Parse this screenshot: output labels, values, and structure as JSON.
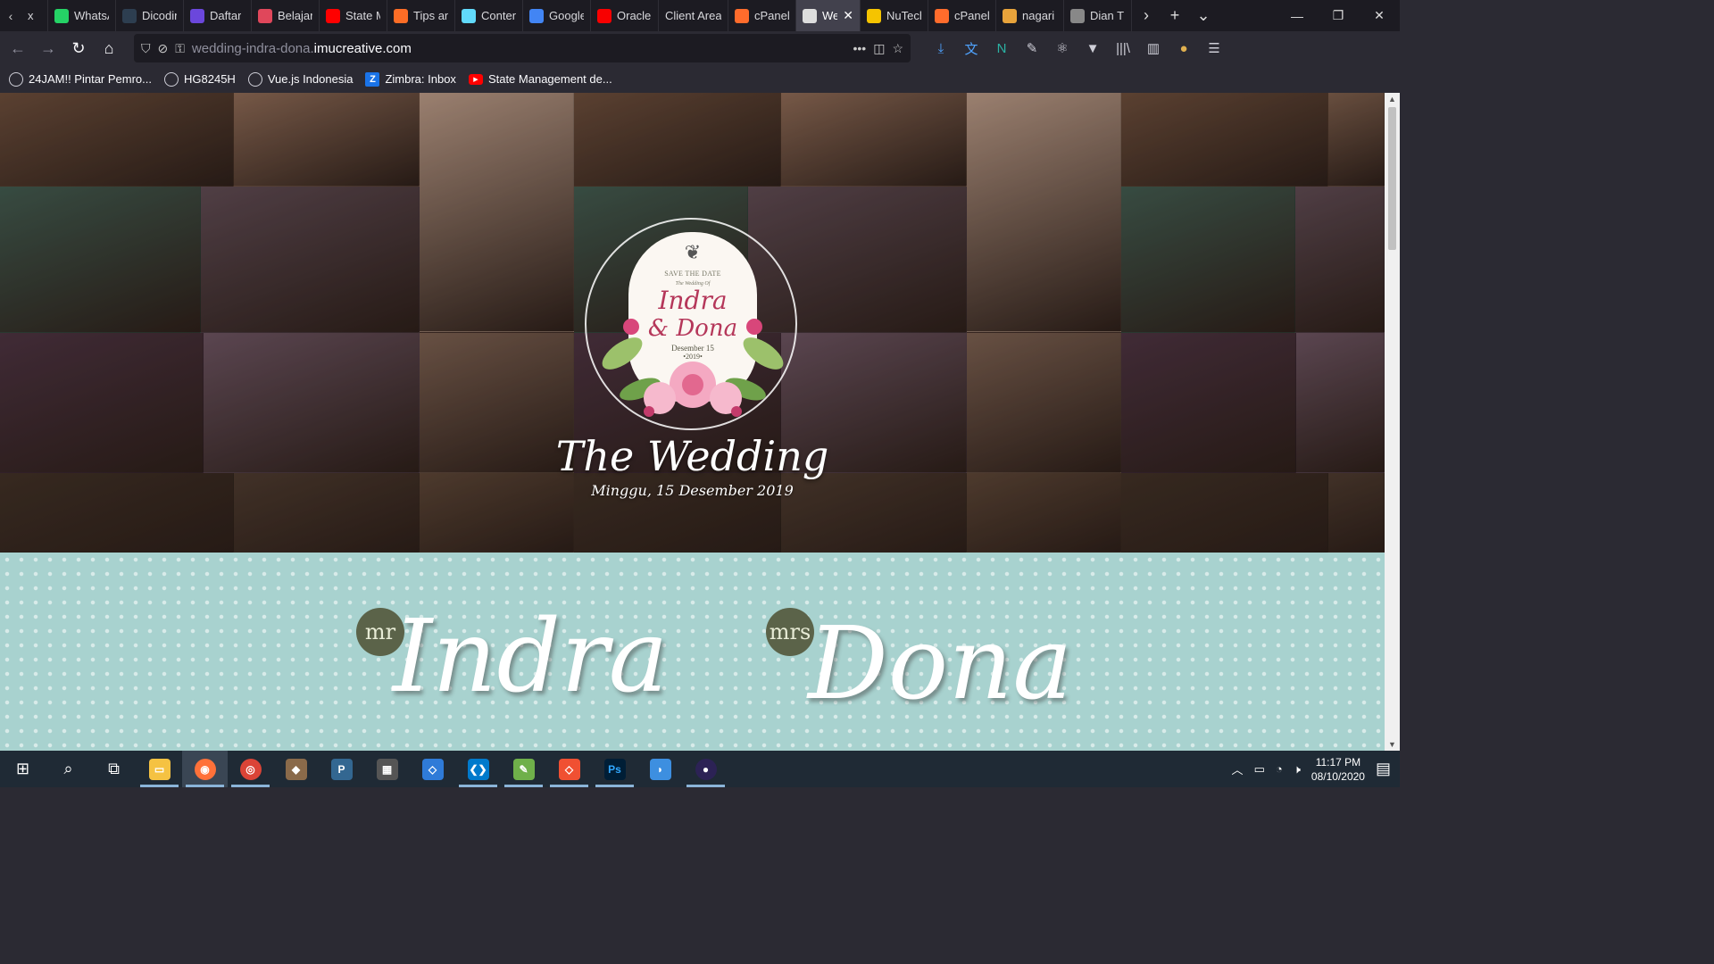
{
  "browser": {
    "tabs": [
      {
        "label": "x",
        "icon": "generic-tab-icon",
        "color": "#555"
      },
      {
        "label": "WhatsApp",
        "icon": "whatsapp-icon",
        "color": "#25d366"
      },
      {
        "label": "Dicoding",
        "icon": "dicoding-icon",
        "color": "#2d3e50"
      },
      {
        "label": "Daftar",
        "icon": "daftar-icon",
        "color": "#6b47dc"
      },
      {
        "label": "Belajar",
        "icon": "belajar-icon",
        "color": "#e0475b"
      },
      {
        "label": "State M",
        "icon": "youtube-icon",
        "color": "#ff0000"
      },
      {
        "label": "Tips an",
        "icon": "gitlab-icon",
        "color": "#fc6d26"
      },
      {
        "label": "Content",
        "icon": "react-icon",
        "color": "#61dafb"
      },
      {
        "label": "Google",
        "icon": "google-translate-icon",
        "color": "#4285f4"
      },
      {
        "label": "Oracle",
        "icon": "oracle-icon",
        "color": "#f80000"
      },
      {
        "label": "Client Area",
        "icon": "none",
        "color": "#1c1b22"
      },
      {
        "label": "cPanel",
        "icon": "cpanel-icon",
        "color": "#ff6c2c"
      },
      {
        "label": "We",
        "icon": "wedding-site-icon",
        "color": "#ddd"
      },
      {
        "label": "NuTech",
        "icon": "nutech-icon",
        "color": "#f5c400"
      },
      {
        "label": "cPanel",
        "icon": "cpanel-icon",
        "color": "#ff6c2c"
      },
      {
        "label": "nagari",
        "icon": "nagari-icon",
        "color": "#e8a33b"
      },
      {
        "label": "Dian T",
        "icon": "dian-icon",
        "color": "#888"
      }
    ],
    "active_tab_index": 12,
    "url": {
      "prefix": "wedding-indra-dona.",
      "domain": "imucreative.com"
    },
    "bookmarks": [
      {
        "label": "24JAM!! Pintar Pemro...",
        "icon": "globe-icon"
      },
      {
        "label": "HG8245H",
        "icon": "globe-icon"
      },
      {
        "label": "Vue.js Indonesia",
        "icon": "globe-icon"
      },
      {
        "label": "Zimbra: Inbox",
        "icon": "zimbra-icon"
      },
      {
        "label": "State Management de...",
        "icon": "youtube-icon"
      }
    ]
  },
  "page": {
    "badge": {
      "save_the_date": "SAVE THE DATE",
      "the_wedding_of": "The Wedding Of",
      "name1": "Indra",
      "name2": "& Dona",
      "date": "Desember 15",
      "year": "•2019•"
    },
    "title": "The Wedding",
    "date": "Minggu, 15 Desember 2019",
    "groom": {
      "title": "mr",
      "name": "Indra"
    },
    "bride": {
      "title": "mrs",
      "name": "Dona"
    }
  },
  "taskbar": {
    "time": "11:17 PM",
    "date": "08/10/2020"
  }
}
